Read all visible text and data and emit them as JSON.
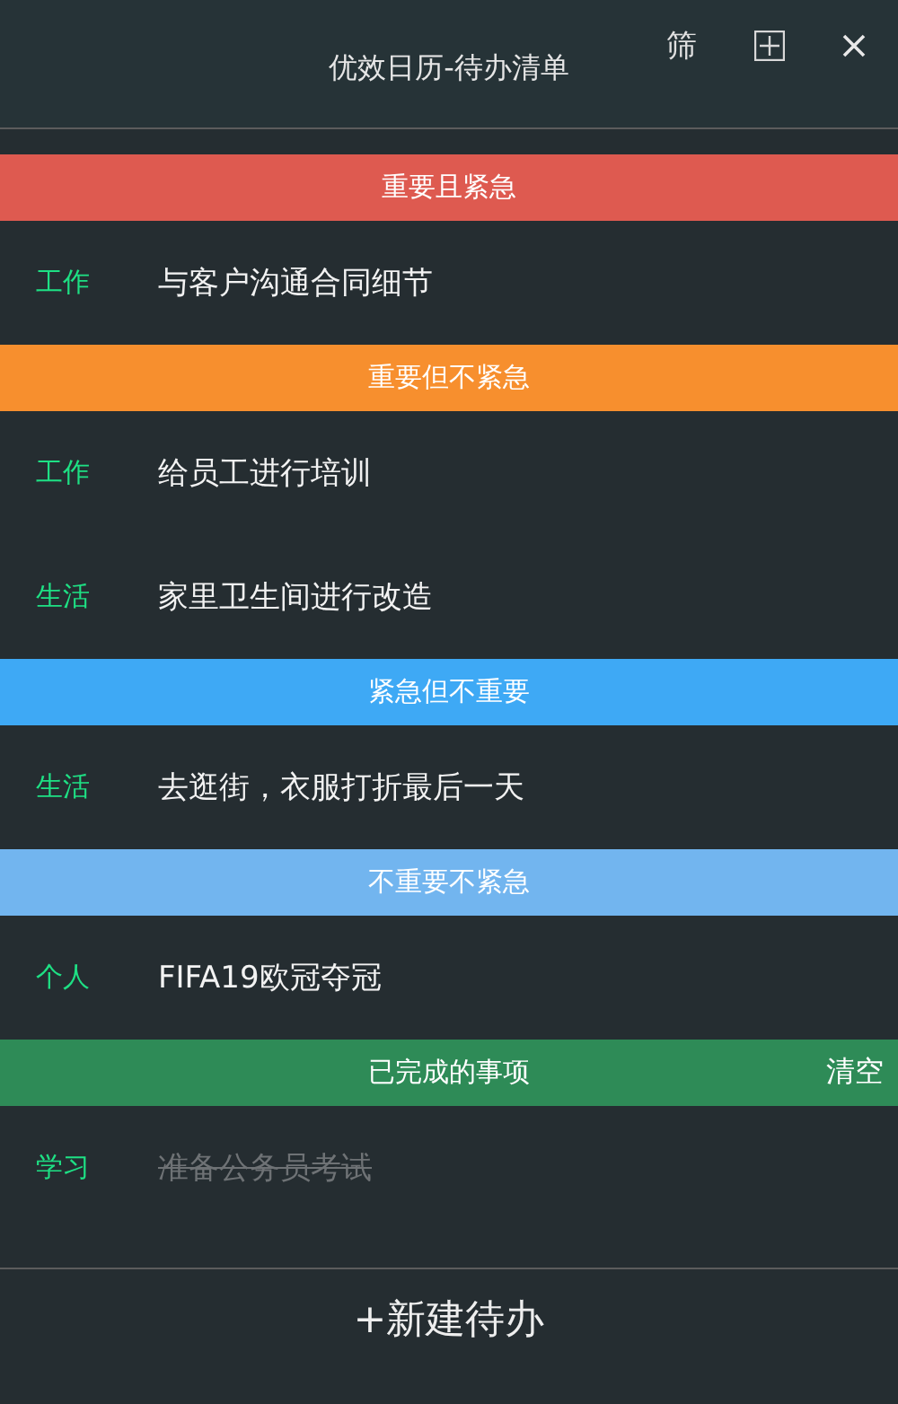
{
  "window": {
    "title": "优效日历-待办清单",
    "filter_button": "筛"
  },
  "sections": [
    {
      "title": "重要且紧急",
      "color": "#de5a50",
      "items": [
        {
          "tag": "工作",
          "text": "与客户沟通合同细节",
          "completed": false
        }
      ]
    },
    {
      "title": "重要但不紧急",
      "color": "#f78f2e",
      "items": [
        {
          "tag": "工作",
          "text": "给员工进行培训",
          "completed": false
        },
        {
          "tag": "生活",
          "text": "家里卫生间进行改造",
          "completed": false
        }
      ]
    },
    {
      "title": "紧急但不重要",
      "color": "#3ea9f5",
      "items": [
        {
          "tag": "生活",
          "text": "去逛街，衣服打折最后一天",
          "completed": false
        }
      ]
    },
    {
      "title": "不重要不紧急",
      "color": "#72b5ef",
      "items": [
        {
          "tag": "个人",
          "text": "FIFA19欧冠夺冠",
          "completed": false
        }
      ]
    },
    {
      "title": "已完成的事项",
      "color": "#2e8b57",
      "action": "清空",
      "items": [
        {
          "tag": "学习",
          "text": "准备公务员考试",
          "completed": true
        }
      ]
    }
  ],
  "new_button": "+新建待办"
}
